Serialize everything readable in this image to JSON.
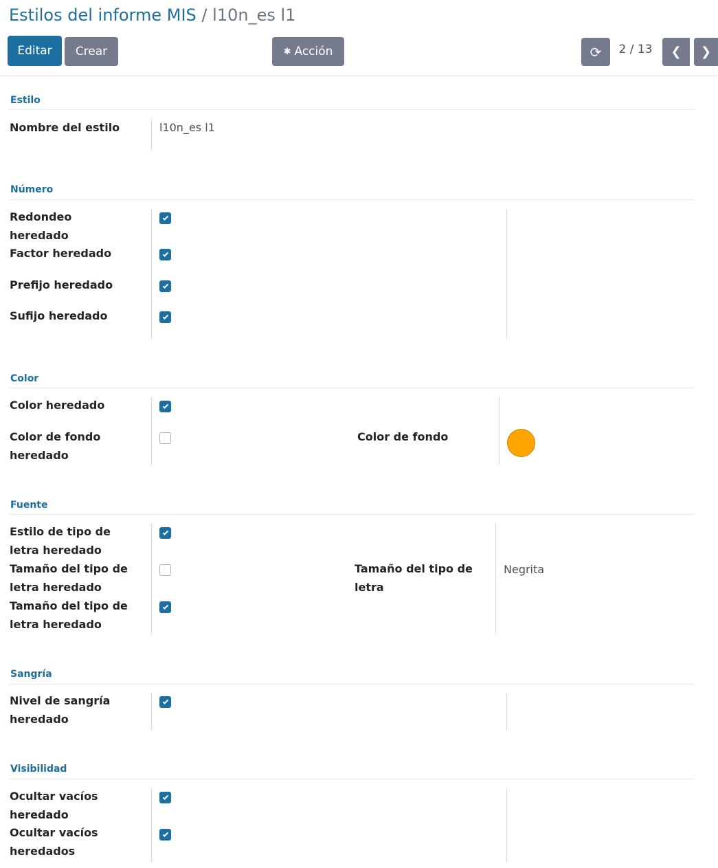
{
  "breadcrumb": {
    "parent": "Estilos del informe MIS",
    "separator": "/",
    "current": "l10n_es l1"
  },
  "toolbar": {
    "edit_label": "Editar",
    "create_label": "Crear",
    "action_label": "Acción",
    "action_icon": "gear-icon",
    "reload_icon": "refresh-icon",
    "pager": "2 / 13",
    "prev_icon": "chevron-left-icon",
    "next_icon": "chevron-right-icon"
  },
  "colors": {
    "primary": "#1c6fa0",
    "secondary": "#757b8c",
    "group_title": "#1b6fa0",
    "swatch": "#ffa500"
  },
  "form": {
    "estilo": {
      "title": "Estilo",
      "style_name_label": "Nombre del estilo",
      "style_name_value": "l10n_es l1"
    },
    "numero": {
      "title": "Número",
      "fields": [
        {
          "label": "Redondeo\nheredado",
          "checked": true
        },
        {
          "label": "Factor heredado",
          "checked": true
        },
        {
          "label": "Prefijo heredado",
          "checked": true
        },
        {
          "label": "Sufijo heredado",
          "checked": true
        }
      ]
    },
    "color": {
      "title": "Color",
      "fields": [
        {
          "label": "Color heredado",
          "checked": true
        },
        {
          "label": "Color de fondo\nheredado",
          "checked": false
        }
      ],
      "bg_color_label": "Color de fondo",
      "bg_color_value": "#ffa500"
    },
    "fuente": {
      "title": "Fuente",
      "fields": [
        {
          "label": "Estilo de tipo de\nletra heredado",
          "checked": true
        },
        {
          "label": "Tamaño del tipo de\nletra heredado",
          "checked": false
        },
        {
          "label": "Tamaño del tipo de\nletra heredado",
          "checked": true
        }
      ],
      "size_label": "Tamaño del tipo de\nletra",
      "size_value": "Negrita"
    },
    "sangria": {
      "title": "Sangría",
      "fields": [
        {
          "label": "Nivel de sangría\nheredado",
          "checked": true
        }
      ]
    },
    "visibilidad": {
      "title": "Visibilidad",
      "fields": [
        {
          "label": "Ocultar vacíos\nheredado",
          "checked": true
        },
        {
          "label": "Ocultar vacíos\nheredados",
          "checked": true
        }
      ]
    }
  }
}
